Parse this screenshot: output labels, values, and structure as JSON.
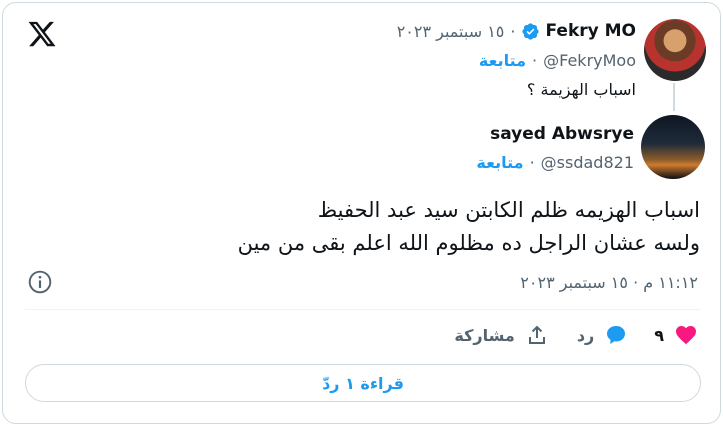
{
  "colors": {
    "accent": "#1d9bf0",
    "like": "#f91880",
    "text": "#0f1419",
    "muted": "#536471",
    "border": "#cfd9de"
  },
  "icons": {
    "logo": "x-logo-icon",
    "verified": "verified-badge-icon",
    "info": "info-icon",
    "like": "heart-icon",
    "reply": "reply-bubble-icon",
    "share": "share-upload-icon"
  },
  "parent_tweet": {
    "name": "Fekry MO",
    "handle": "@FekryMoo",
    "date": "١٥ سبتمبر ٢٠٢٣",
    "dot": "·",
    "follow_label": "متابعة",
    "text": "اسباب الهزيمة ؟"
  },
  "main_tweet": {
    "name": "sayed Abwsrye",
    "handle": "@ssdad821",
    "dot": "·",
    "follow_label": "متابعة",
    "text_line1": "اسباب الهزيمه ظلم الكابتن سيد عبد الحفيظ",
    "text_line2": "ولسه عشان الراجل ده مظلوم الله اعلم بقى من مين",
    "timestamp": "١١:١٢ م · ١٥ سبتمبر ٢٠٢٣"
  },
  "actions": {
    "like_count": "٩",
    "reply_label": "رد",
    "share_label": "مشاركة"
  },
  "read_replies_label": "قراءة ١ ردّ"
}
